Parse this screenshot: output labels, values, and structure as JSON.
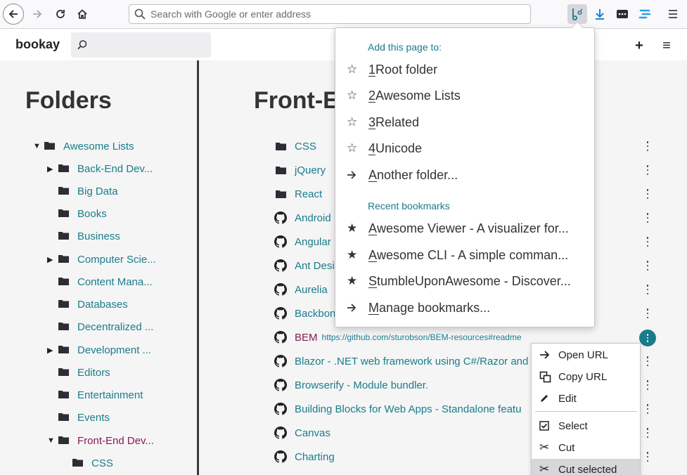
{
  "browser": {
    "address_placeholder": "Search with Google or enter address"
  },
  "app": {
    "logo": "bookay",
    "search_placeholder": "",
    "add_label": "+",
    "menu_label": "≡"
  },
  "folders_panel": {
    "title": "Folders",
    "items": [
      {
        "label": "Awesome Lists",
        "expanded": true,
        "indent": 0
      },
      {
        "label": "Back-End Dev...",
        "has_children": true,
        "indent": 1
      },
      {
        "label": "Big Data",
        "indent": 1
      },
      {
        "label": "Books",
        "indent": 1
      },
      {
        "label": "Business",
        "indent": 1
      },
      {
        "label": "Computer Scie...",
        "has_children": true,
        "indent": 1
      },
      {
        "label": "Content Mana...",
        "indent": 1
      },
      {
        "label": "Databases",
        "indent": 1
      },
      {
        "label": "Decentralized ...",
        "indent": 1
      },
      {
        "label": "Development ...",
        "has_children": true,
        "indent": 1
      },
      {
        "label": "Editors",
        "indent": 1
      },
      {
        "label": "Entertainment",
        "indent": 1
      },
      {
        "label": "Events",
        "indent": 1
      },
      {
        "label": "Front-End Dev...",
        "expanded": true,
        "selected": true,
        "indent": 1
      },
      {
        "label": "CSS",
        "indent": 2
      }
    ]
  },
  "main": {
    "title": "Front-E",
    "items": [
      {
        "type": "folder",
        "label": "CSS"
      },
      {
        "type": "folder",
        "label": "jQuery"
      },
      {
        "type": "folder",
        "label": "React"
      },
      {
        "type": "github",
        "label": "Android"
      },
      {
        "type": "github",
        "label": "Angular"
      },
      {
        "type": "github",
        "label": "Ant Desi"
      },
      {
        "type": "github",
        "label": "Aurelia"
      },
      {
        "type": "github",
        "label": "Backbon"
      },
      {
        "type": "github",
        "label": "BEM",
        "url": "https://github.com/sturobson/BEM-resources#readme",
        "active": true
      },
      {
        "type": "github",
        "label": "Blazor - .NET web framework using C#/Razor and"
      },
      {
        "type": "github",
        "label": "Browserify - Module bundler."
      },
      {
        "type": "github",
        "label": "Building Blocks for Web Apps - Standalone featu"
      },
      {
        "type": "github",
        "label": "Canvas"
      },
      {
        "type": "github",
        "label": "Charting"
      }
    ]
  },
  "context_menu": {
    "items": [
      {
        "label": "Open URL",
        "icon": "arrow-right-icon"
      },
      {
        "label": "Copy URL",
        "icon": "copy-icon"
      },
      {
        "label": "Edit",
        "icon": "pencil-icon"
      },
      {
        "label": "Select",
        "icon": "checkbox-icon"
      },
      {
        "label": "Cut",
        "icon": "scissors-icon"
      },
      {
        "label": "Cut selected",
        "icon": "scissors-icon"
      }
    ]
  },
  "bookmark_popup": {
    "add_heading": "Add this page to:",
    "folders": [
      {
        "number": "1",
        "label": " Root folder"
      },
      {
        "number": "2",
        "label": " Awesome Lists"
      },
      {
        "number": "3",
        "label": " Related"
      },
      {
        "number": "4",
        "label": " Unicode"
      }
    ],
    "another_folder": {
      "first": "A",
      "rest": "nother folder..."
    },
    "recent_heading": "Recent bookmarks",
    "recent": [
      {
        "first": "A",
        "rest": "wesome Viewer - A visualizer for..."
      },
      {
        "first": "A",
        "rest": "wesome CLI - A simple comman..."
      },
      {
        "first": "S",
        "rest": "tumbleUponAwesome - Discover..."
      }
    ],
    "manage": {
      "first": "M",
      "rest": "anage bookmarks..."
    }
  },
  "colors": {
    "accent": "#1a7c8a",
    "selected": "#8c1a50",
    "panel_bg": "#f5f5f6"
  }
}
